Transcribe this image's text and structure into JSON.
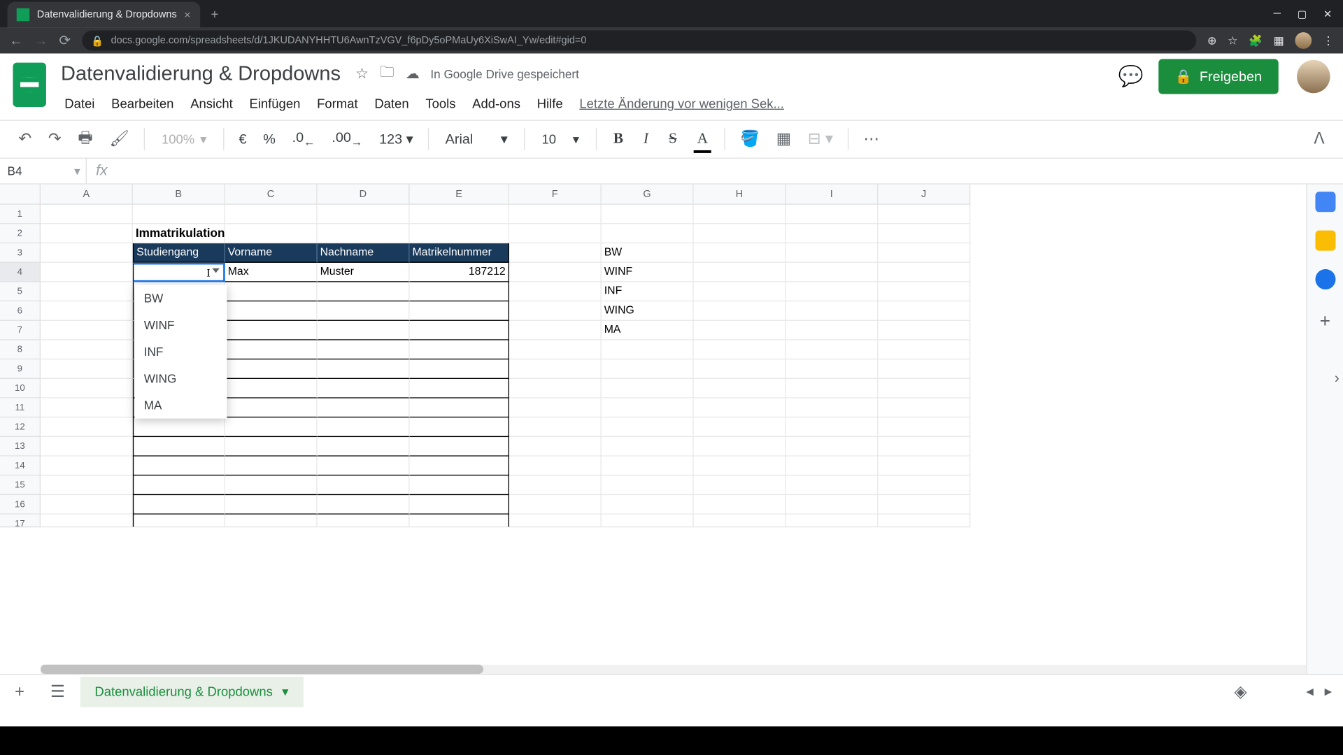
{
  "browser": {
    "tab_title": "Datenvalidierung & Dropdowns",
    "url": "docs.google.com/spreadsheets/d/1JKUDANYHHTU6AwnTzVGV_f6pDy5oPMaUy6XiSwAI_Yw/edit#gid=0"
  },
  "doc": {
    "title": "Datenvalidierung & Dropdowns",
    "save_status": "In Google Drive gespeichert",
    "history": "Letzte Änderung vor wenigen Sek...",
    "share": "Freigeben"
  },
  "menu": {
    "datei": "Datei",
    "bearbeiten": "Bearbeiten",
    "ansicht": "Ansicht",
    "einfuegen": "Einfügen",
    "format": "Format",
    "daten": "Daten",
    "tools": "Tools",
    "addons": "Add-ons",
    "hilfe": "Hilfe"
  },
  "toolbar": {
    "zoom": "100%",
    "currency": "€",
    "percent": "%",
    "dec_less": ".0",
    "dec_more": ".00",
    "num_fmt": "123",
    "font": "Arial",
    "size": "10"
  },
  "namebox": "B4",
  "cols": [
    "A",
    "B",
    "C",
    "D",
    "E",
    "F",
    "G",
    "H",
    "I",
    "J"
  ],
  "rows": [
    "1",
    "2",
    "3",
    "4",
    "5",
    "6",
    "7",
    "8",
    "9",
    "10",
    "11",
    "12",
    "13",
    "14",
    "15",
    "16",
    "17"
  ],
  "table": {
    "title": "Immatrikulation",
    "headers": [
      "Studiengang",
      "Vorname",
      "Nachname",
      "Matrikelnummer"
    ],
    "row4": {
      "vorname": "Max",
      "nachname": "Muster",
      "matrikel": "187212"
    }
  },
  "dropdown": [
    "BW",
    "WINF",
    "INF",
    "WING",
    "MA"
  ],
  "source_list": [
    "BW",
    "WINF",
    "INF",
    "WING",
    "MA"
  ],
  "sheet_tab": "Datenvalidierung & Dropdowns"
}
